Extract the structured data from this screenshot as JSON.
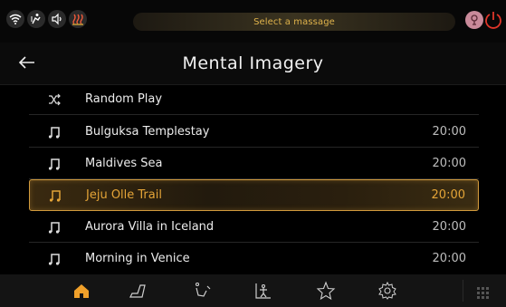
{
  "status": {
    "message_pill": "Select a massage",
    "icons": [
      "wifi-icon",
      "person-lift-icon",
      "speaker-icon",
      "heat-icon",
      "profile-icon",
      "power-icon"
    ],
    "accent": "#e0b34c"
  },
  "header": {
    "title": "Mental Imagery"
  },
  "list": {
    "items": [
      {
        "label": "Random Play",
        "duration": "",
        "icon": "shuffle-icon",
        "selected": false
      },
      {
        "label": "Bulguksa Templestay",
        "duration": "20:00",
        "icon": "music-note-icon",
        "selected": false
      },
      {
        "label": "Maldives Sea",
        "duration": "20:00",
        "icon": "music-note-icon",
        "selected": false
      },
      {
        "label": "Jeju Olle Trail",
        "duration": "20:00",
        "icon": "music-note-icon",
        "selected": true
      },
      {
        "label": "Aurora Villa in Iceland",
        "duration": "20:00",
        "icon": "music-note-icon",
        "selected": false
      },
      {
        "label": "Morning in Venice",
        "duration": "20:00",
        "icon": "music-note-icon",
        "selected": false
      }
    ],
    "selected_color": "#e4a437"
  },
  "bottom_nav": {
    "items": [
      "home-icon",
      "chair-icon",
      "recline-icon",
      "stretch-icon",
      "star-icon",
      "settings-icon"
    ],
    "active": "home-icon"
  }
}
